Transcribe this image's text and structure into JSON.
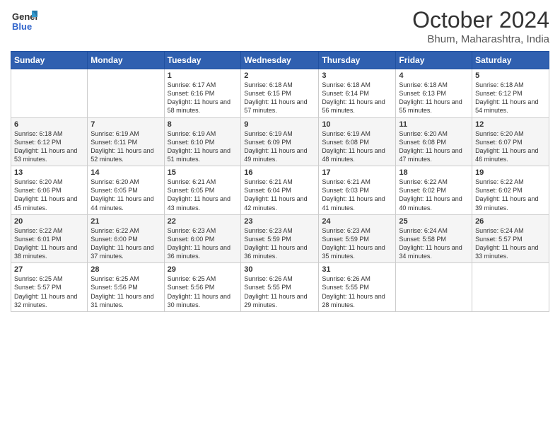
{
  "logo": {
    "general": "General",
    "blue": "Blue"
  },
  "header": {
    "month": "October 2024",
    "location": "Bhum, Maharashtra, India"
  },
  "weekdays": [
    "Sunday",
    "Monday",
    "Tuesday",
    "Wednesday",
    "Thursday",
    "Friday",
    "Saturday"
  ],
  "weeks": [
    [
      {
        "day": "",
        "sunrise": "",
        "sunset": "",
        "daylight": ""
      },
      {
        "day": "",
        "sunrise": "",
        "sunset": "",
        "daylight": ""
      },
      {
        "day": "1",
        "sunrise": "Sunrise: 6:17 AM",
        "sunset": "Sunset: 6:16 PM",
        "daylight": "Daylight: 11 hours and 58 minutes."
      },
      {
        "day": "2",
        "sunrise": "Sunrise: 6:18 AM",
        "sunset": "Sunset: 6:15 PM",
        "daylight": "Daylight: 11 hours and 57 minutes."
      },
      {
        "day": "3",
        "sunrise": "Sunrise: 6:18 AM",
        "sunset": "Sunset: 6:14 PM",
        "daylight": "Daylight: 11 hours and 56 minutes."
      },
      {
        "day": "4",
        "sunrise": "Sunrise: 6:18 AM",
        "sunset": "Sunset: 6:13 PM",
        "daylight": "Daylight: 11 hours and 55 minutes."
      },
      {
        "day": "5",
        "sunrise": "Sunrise: 6:18 AM",
        "sunset": "Sunset: 6:12 PM",
        "daylight": "Daylight: 11 hours and 54 minutes."
      }
    ],
    [
      {
        "day": "6",
        "sunrise": "Sunrise: 6:18 AM",
        "sunset": "Sunset: 6:12 PM",
        "daylight": "Daylight: 11 hours and 53 minutes."
      },
      {
        "day": "7",
        "sunrise": "Sunrise: 6:19 AM",
        "sunset": "Sunset: 6:11 PM",
        "daylight": "Daylight: 11 hours and 52 minutes."
      },
      {
        "day": "8",
        "sunrise": "Sunrise: 6:19 AM",
        "sunset": "Sunset: 6:10 PM",
        "daylight": "Daylight: 11 hours and 51 minutes."
      },
      {
        "day": "9",
        "sunrise": "Sunrise: 6:19 AM",
        "sunset": "Sunset: 6:09 PM",
        "daylight": "Daylight: 11 hours and 49 minutes."
      },
      {
        "day": "10",
        "sunrise": "Sunrise: 6:19 AM",
        "sunset": "Sunset: 6:08 PM",
        "daylight": "Daylight: 11 hours and 48 minutes."
      },
      {
        "day": "11",
        "sunrise": "Sunrise: 6:20 AM",
        "sunset": "Sunset: 6:08 PM",
        "daylight": "Daylight: 11 hours and 47 minutes."
      },
      {
        "day": "12",
        "sunrise": "Sunrise: 6:20 AM",
        "sunset": "Sunset: 6:07 PM",
        "daylight": "Daylight: 11 hours and 46 minutes."
      }
    ],
    [
      {
        "day": "13",
        "sunrise": "Sunrise: 6:20 AM",
        "sunset": "Sunset: 6:06 PM",
        "daylight": "Daylight: 11 hours and 45 minutes."
      },
      {
        "day": "14",
        "sunrise": "Sunrise: 6:20 AM",
        "sunset": "Sunset: 6:05 PM",
        "daylight": "Daylight: 11 hours and 44 minutes."
      },
      {
        "day": "15",
        "sunrise": "Sunrise: 6:21 AM",
        "sunset": "Sunset: 6:05 PM",
        "daylight": "Daylight: 11 hours and 43 minutes."
      },
      {
        "day": "16",
        "sunrise": "Sunrise: 6:21 AM",
        "sunset": "Sunset: 6:04 PM",
        "daylight": "Daylight: 11 hours and 42 minutes."
      },
      {
        "day": "17",
        "sunrise": "Sunrise: 6:21 AM",
        "sunset": "Sunset: 6:03 PM",
        "daylight": "Daylight: 11 hours and 41 minutes."
      },
      {
        "day": "18",
        "sunrise": "Sunrise: 6:22 AM",
        "sunset": "Sunset: 6:02 PM",
        "daylight": "Daylight: 11 hours and 40 minutes."
      },
      {
        "day": "19",
        "sunrise": "Sunrise: 6:22 AM",
        "sunset": "Sunset: 6:02 PM",
        "daylight": "Daylight: 11 hours and 39 minutes."
      }
    ],
    [
      {
        "day": "20",
        "sunrise": "Sunrise: 6:22 AM",
        "sunset": "Sunset: 6:01 PM",
        "daylight": "Daylight: 11 hours and 38 minutes."
      },
      {
        "day": "21",
        "sunrise": "Sunrise: 6:22 AM",
        "sunset": "Sunset: 6:00 PM",
        "daylight": "Daylight: 11 hours and 37 minutes."
      },
      {
        "day": "22",
        "sunrise": "Sunrise: 6:23 AM",
        "sunset": "Sunset: 6:00 PM",
        "daylight": "Daylight: 11 hours and 36 minutes."
      },
      {
        "day": "23",
        "sunrise": "Sunrise: 6:23 AM",
        "sunset": "Sunset: 5:59 PM",
        "daylight": "Daylight: 11 hours and 36 minutes."
      },
      {
        "day": "24",
        "sunrise": "Sunrise: 6:23 AM",
        "sunset": "Sunset: 5:59 PM",
        "daylight": "Daylight: 11 hours and 35 minutes."
      },
      {
        "day": "25",
        "sunrise": "Sunrise: 6:24 AM",
        "sunset": "Sunset: 5:58 PM",
        "daylight": "Daylight: 11 hours and 34 minutes."
      },
      {
        "day": "26",
        "sunrise": "Sunrise: 6:24 AM",
        "sunset": "Sunset: 5:57 PM",
        "daylight": "Daylight: 11 hours and 33 minutes."
      }
    ],
    [
      {
        "day": "27",
        "sunrise": "Sunrise: 6:25 AM",
        "sunset": "Sunset: 5:57 PM",
        "daylight": "Daylight: 11 hours and 32 minutes."
      },
      {
        "day": "28",
        "sunrise": "Sunrise: 6:25 AM",
        "sunset": "Sunset: 5:56 PM",
        "daylight": "Daylight: 11 hours and 31 minutes."
      },
      {
        "day": "29",
        "sunrise": "Sunrise: 6:25 AM",
        "sunset": "Sunset: 5:56 PM",
        "daylight": "Daylight: 11 hours and 30 minutes."
      },
      {
        "day": "30",
        "sunrise": "Sunrise: 6:26 AM",
        "sunset": "Sunset: 5:55 PM",
        "daylight": "Daylight: 11 hours and 29 minutes."
      },
      {
        "day": "31",
        "sunrise": "Sunrise: 6:26 AM",
        "sunset": "Sunset: 5:55 PM",
        "daylight": "Daylight: 11 hours and 28 minutes."
      },
      {
        "day": "",
        "sunrise": "",
        "sunset": "",
        "daylight": ""
      },
      {
        "day": "",
        "sunrise": "",
        "sunset": "",
        "daylight": ""
      }
    ]
  ]
}
